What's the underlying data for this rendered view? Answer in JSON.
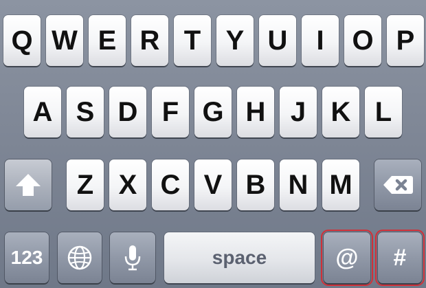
{
  "keyboard": {
    "row1": [
      "Q",
      "W",
      "E",
      "R",
      "T",
      "Y",
      "U",
      "I",
      "O",
      "P"
    ],
    "row2": [
      "A",
      "S",
      "D",
      "F",
      "G",
      "H",
      "J",
      "K",
      "L"
    ],
    "row3": [
      "Z",
      "X",
      "C",
      "V",
      "B",
      "N",
      "M"
    ],
    "row4": {
      "numbers_label": "123",
      "space_label": "space",
      "at_label": "@",
      "hash_label": "#"
    },
    "icons": {
      "shift": "shift-arrow-icon",
      "backspace": "backspace-icon",
      "globe": "globe-icon",
      "mic": "microphone-icon"
    },
    "colors": {
      "highlight": "#d03038",
      "key_face": "#ffffff",
      "keyboard_bg": "#7f8796"
    }
  }
}
